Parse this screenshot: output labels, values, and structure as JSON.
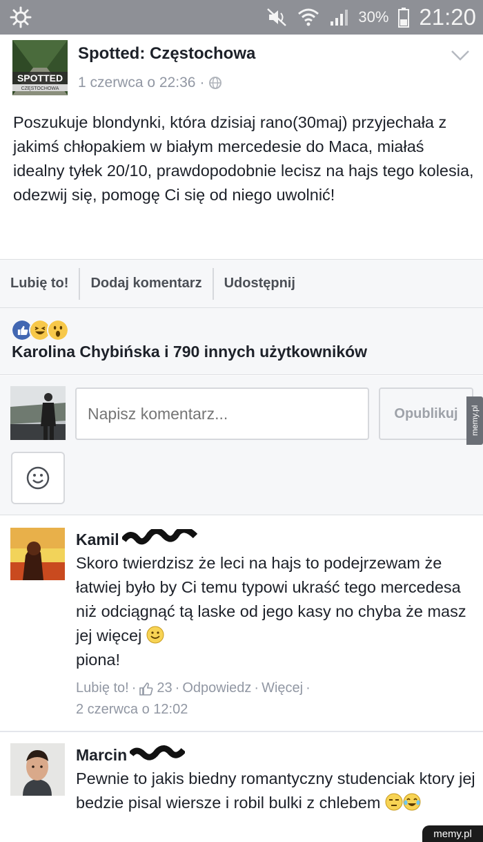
{
  "status_bar": {
    "battery_percent": "30%",
    "time": "21:20",
    "icons": [
      "settings-gear-icon",
      "mute-icon",
      "wifi-icon",
      "signal-icon",
      "battery-icon"
    ]
  },
  "post": {
    "page_name": "Spotted: Częstochowa",
    "logo_text": "SPOTTED",
    "logo_subtext": "CZĘSTOCHOWA",
    "date": "1 czerwca o 22:36",
    "separator": "·",
    "text": "Poszukuje blondynki, która dzisiaj rano(30maj) przyjechała z jakimś chłopakiem w białym mercedesie do Maca, miałaś idealny tyłek 20/10, prawdopodobnie lecisz na hajs tego kolesia, odezwij się, pomogę Ci się od niego uwolnić!"
  },
  "actions": {
    "like": "Lubię to!",
    "comment": "Dodaj komentarz",
    "share": "Udostępnij"
  },
  "reactions": {
    "summary": "Karolina Chybińska i 790 innych użytkowników",
    "icons": [
      "like-reaction-icon",
      "haha-reaction-icon",
      "wow-reaction-icon"
    ]
  },
  "composer": {
    "placeholder": "Napisz komentarz...",
    "publish_label": "Opublikuj"
  },
  "comments": [
    {
      "author": "Kamil",
      "text": "Skoro twierdzisz że leci na hajs to podejrzewam że łatwiej było by Ci temu typowi ukraść tego mercedesa niż odciągnąć tą laske od jego kasy no chyba że masz jej więcej",
      "text_end": "piona!",
      "like_label": "Lubię to!",
      "like_count": "23",
      "reply_label": "Odpowiedz",
      "more_label": "Więcej",
      "separator": "·",
      "time": "2 czerwca o 12:02"
    },
    {
      "author": "Marcin",
      "text": "Pewnie to jakis biedny romantyczny studenciak ktory jej bedzie pisal wiersze i robil bulki z chlebem"
    }
  ],
  "watermarks": {
    "side": "memy.pl",
    "corner": "memy.pl"
  },
  "colors": {
    "status_bar": "#8e9096",
    "text": "#1d2129",
    "meta": "#9197a3",
    "panel": "#f6f7f9",
    "like_blue": "#4267b2",
    "reaction_yellow": "#f7c84a"
  }
}
